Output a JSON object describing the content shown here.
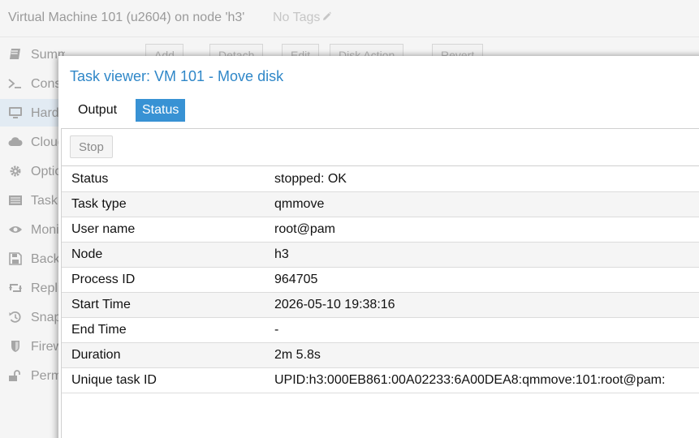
{
  "vm_header": {
    "title": "Virtual Machine 101 (u2604) on node 'h3'",
    "tags_label": "No Tags",
    "tags_icon": "pencil-icon"
  },
  "sidebar": {
    "items": [
      {
        "label": "Summary",
        "icon": "book-icon"
      },
      {
        "label": "Console",
        "icon": "terminal-icon"
      },
      {
        "label": "Hardware",
        "icon": "monitor-icon",
        "active": true
      },
      {
        "label": "Cloud-Init",
        "icon": "cloud-icon"
      },
      {
        "label": "Options",
        "icon": "gear-icon"
      },
      {
        "label": "Task History",
        "icon": "list-icon"
      },
      {
        "label": "Monitor",
        "icon": "eye-icon"
      },
      {
        "label": "Backup",
        "icon": "floppy-icon"
      },
      {
        "label": "Replication",
        "icon": "retweet-icon"
      },
      {
        "label": "Snapshots",
        "icon": "history-icon"
      },
      {
        "label": "Firewall",
        "icon": "shield-icon"
      },
      {
        "label": "Permissions",
        "icon": "unlock-icon"
      }
    ]
  },
  "bg_toolbar": {
    "add": "Add",
    "detach": "Detach",
    "edit": "Edit",
    "disk_action": "Disk Action",
    "revert": "Revert"
  },
  "task_viewer": {
    "title": "Task viewer: VM 101 - Move disk",
    "tabs": [
      {
        "label": "Output"
      },
      {
        "label": "Status",
        "active": true
      }
    ],
    "stop_label": "Stop",
    "rows": [
      {
        "key": "Status",
        "value": "stopped: OK"
      },
      {
        "key": "Task type",
        "value": "qmmove"
      },
      {
        "key": "User name",
        "value": "root@pam"
      },
      {
        "key": "Node",
        "value": "h3"
      },
      {
        "key": "Process ID",
        "value": "964705"
      },
      {
        "key": "Start Time",
        "value": "2026-05-10 19:38:16"
      },
      {
        "key": "End Time",
        "value": "-"
      },
      {
        "key": "Duration",
        "value": "2m 5.8s"
      },
      {
        "key": "Unique task ID",
        "value": "UPID:h3:000EB861:00A02233:6A00DEA8:qmmove:101:root@pam:"
      }
    ]
  },
  "colors": {
    "accent": "#2f87c8",
    "active_tab": "#3892d4",
    "sidebar_active": "#e2ebf3"
  }
}
